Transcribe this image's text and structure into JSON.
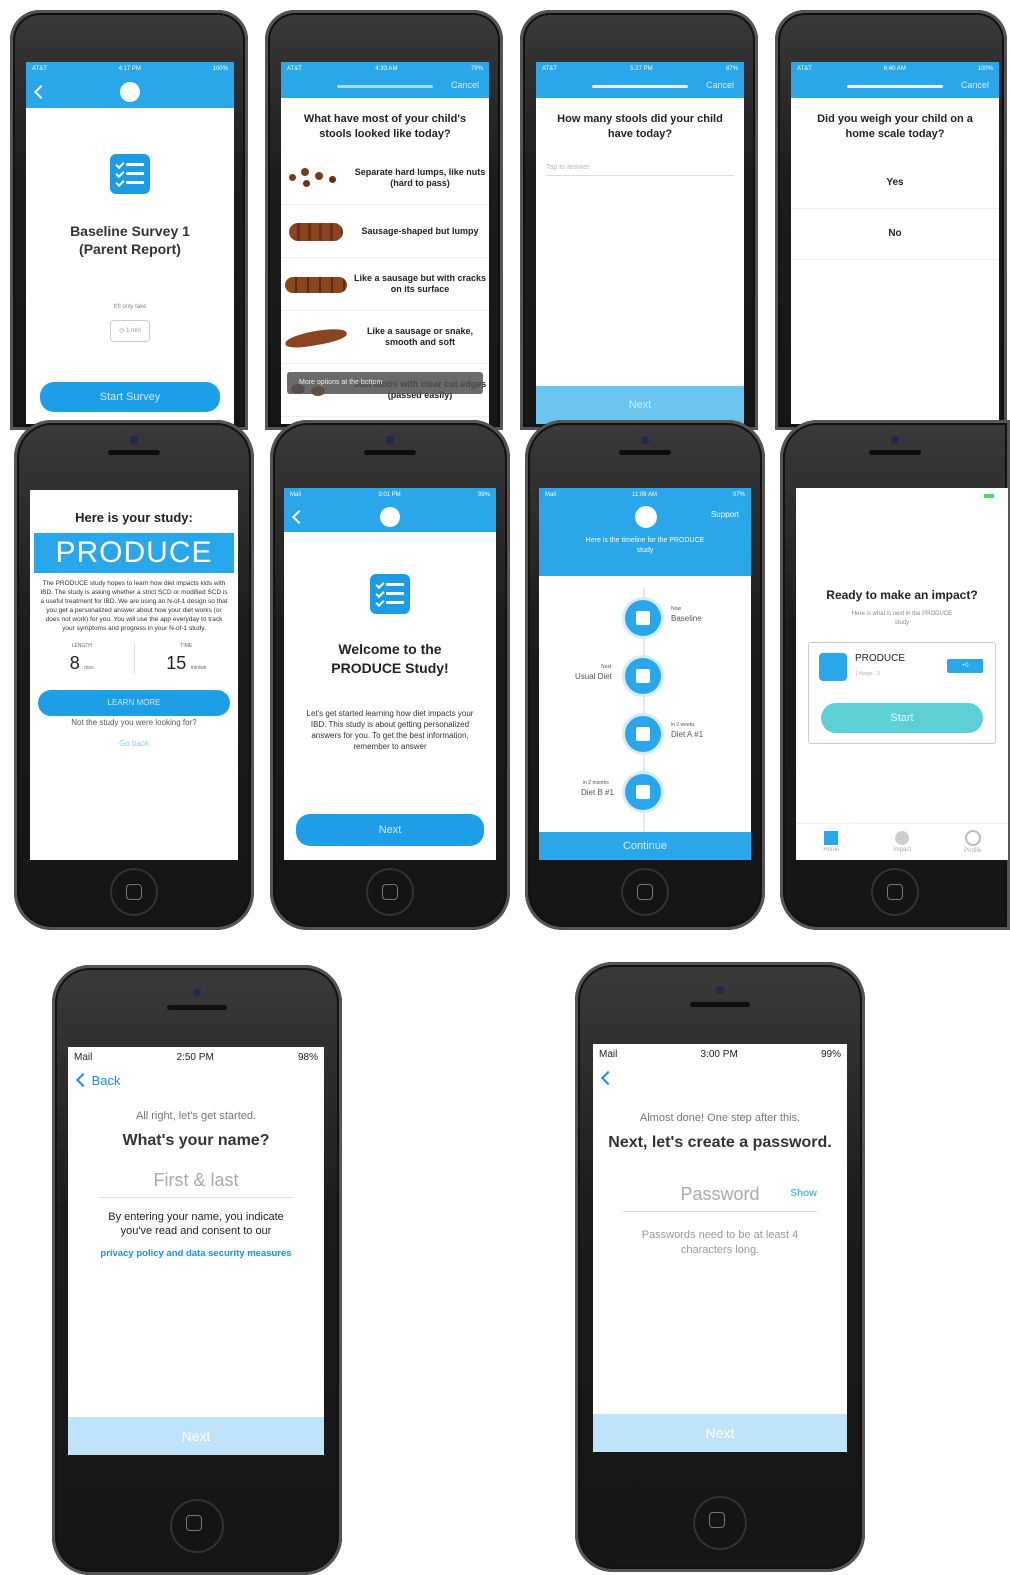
{
  "p1": {
    "title": "Baseline Survey 1\n(Parent Report)",
    "duration_label": "It'll only take",
    "duration_value": "1 min",
    "start_btn": "Start Survey"
  },
  "p2": {
    "cancel": "Cancel",
    "question": "What have most of your child's stools looked like today?",
    "options": [
      "Separate hard lumps, like nuts (hard to pass)",
      "Sausage-shaped but lumpy",
      "Like a sausage but with cracks on its surface",
      "Like a sausage or snake, smooth and soft",
      "Soft blobs with clear cut edges (passed easily)"
    ],
    "toast": "More options at the bottom"
  },
  "p3": {
    "cancel": "Cancel",
    "question": "How many stools did your child have today?",
    "placeholder": "Tap to answer",
    "next": "Next"
  },
  "p4": {
    "cancel": "Cancel",
    "question": "Did you weigh your child on a home scale today?",
    "options": [
      "Yes",
      "No"
    ]
  },
  "p5": {
    "header": "Here is your study:",
    "brand": "PRODUCE",
    "description": "The PRODUCE study hopes to learn how diet impacts kids with IBD. The study is asking whether a strict SCD or modified SCD is a useful treatment for IBD. We are using an N-of-1 design so that you get a personalized answer about how your diet works (or does not work) for you. You will use the app everyday to track your symptoms and progress in your N-of-1 study.",
    "length_label": "LENGTH",
    "length_value": "8",
    "length_unit": "mos",
    "time_label": "TIME",
    "time_value": "15",
    "time_unit": "min/wk",
    "learn_more": "LEARN MORE",
    "not_study": "Not the study you were looking for?",
    "go_back": "Go back"
  },
  "p6": {
    "title": "Welcome to the PRODUCE Study!",
    "body": "Let's get started learning how diet impacts your IBD. This study is about getting personalized answers for you. To get the best information, remember to answer",
    "next": "Next"
  },
  "p7": {
    "support": "Support",
    "header": "Here is the timeline for the PRODUCE study",
    "steps": [
      {
        "sub": "Now",
        "label": "Baseline"
      },
      {
        "sub": "Next",
        "label": "Usual Diet"
      },
      {
        "sub": "in 2 weeks",
        "label": "Diet A #1"
      },
      {
        "sub": "in 2 months",
        "label": "Diet B #1"
      }
    ],
    "continue": "Continue"
  },
  "p8": {
    "title": "Ready to make an impact?",
    "subtitle": "Here is what is next in the PRODUCE study",
    "card_name": "PRODUCE",
    "card_meta": "1 things · 3",
    "badge": "+0",
    "start": "Start",
    "tabs": [
      "Home",
      "Impact",
      "Profile"
    ]
  },
  "p9": {
    "status_left": "Mail",
    "time": "2:50 PM",
    "battery": "98%",
    "back": "Back",
    "intro": "All right, let's get started.",
    "question": "What's your name?",
    "placeholder": "First & last",
    "consent": "By entering your name, you indicate you've read and consent to our",
    "link": "privacy policy and data security measures",
    "next": "Next"
  },
  "p10": {
    "status_left": "Mail",
    "time": "3:00 PM",
    "battery": "99%",
    "intro": "Almost done! One step after this.",
    "question": "Next, let's create a password.",
    "placeholder": "Password",
    "show": "Show",
    "hint": "Passwords need to be at least 4 characters long.",
    "next": "Next"
  },
  "colors": {
    "primary": "#29a7ea",
    "button": "#1f9ee8",
    "next_bar_light": "#bfe3f8",
    "teal_button": "#5dcfd6"
  }
}
